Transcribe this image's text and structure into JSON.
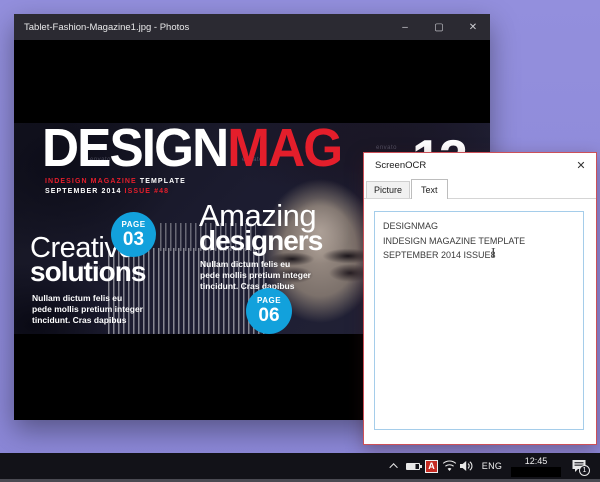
{
  "photos_window": {
    "title": "Tablet-Fashion-Magazine1.jpg - Photos",
    "controls": {
      "minimize": "–",
      "maximize": "▢",
      "close": "✕"
    }
  },
  "magazine": {
    "masthead": {
      "white": "DESIGN",
      "red": "MAG"
    },
    "subtitle_line1": {
      "red": "INDESIGN MAGAZINE ",
      "white": "TEMPLATE"
    },
    "subtitle_line2": {
      "white": "SEPTEMBER 2014 ",
      "red": "ISSUE #48"
    },
    "corner_number": "12",
    "watermark": "envato",
    "left_feature": {
      "title_light": "Creative",
      "title_bold": "solutions",
      "body": "Nullam dictum felis eu\npede mollis pretium integer\ntincidunt. Cras dapibus",
      "page_badge": {
        "label": "PAGE",
        "number": "03"
      }
    },
    "center_feature": {
      "title_light": "Amazing",
      "title_bold": "designers",
      "body": "Nullam dictum felis eu\npede mollis pretium integer\ntincidunt. Cras dapibus",
      "page_badge": {
        "label": "PAGE",
        "number": "06"
      }
    },
    "colors": {
      "red": "#e41e2b",
      "badge_blue": "#12a1dc"
    }
  },
  "screenocr": {
    "title": "ScreenOCR",
    "close": "✕",
    "tabs": [
      {
        "label": "Picture",
        "active": false
      },
      {
        "label": "Text",
        "active": true
      }
    ],
    "ocr_text": "DESIGNMAG\nINDESIGN MAGAZINE TEMPLATE\nSEPTEMBER 2014 ISSUE8",
    "colors": {
      "border": "#cc5058",
      "textarea_border": "#a5cdea"
    }
  },
  "taskbar": {
    "ime_letter": "A",
    "language": "ENG",
    "time": "12:45",
    "notification_badge": "1",
    "colors": {
      "bar": "#121218"
    }
  }
}
